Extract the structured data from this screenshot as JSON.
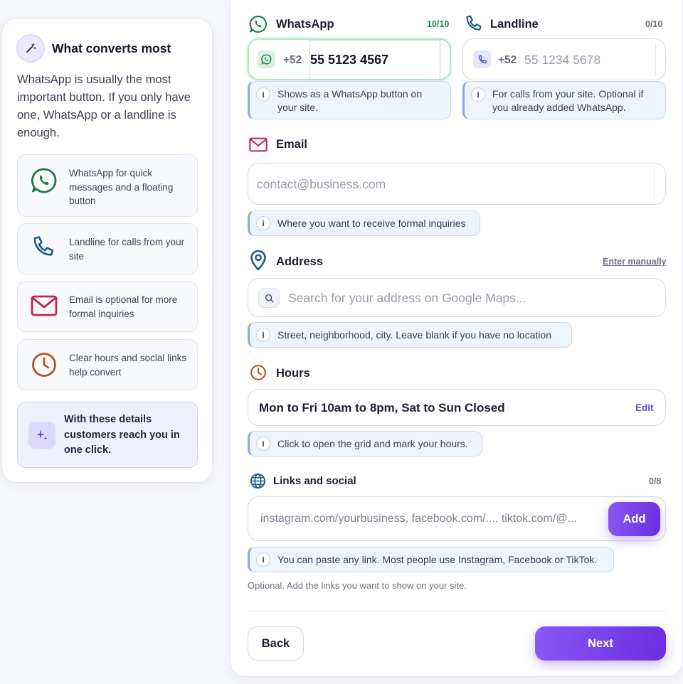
{
  "sidebar": {
    "title": "What converts most",
    "description": "WhatsApp is usually the most important button. If you only have one, WhatsApp or a landline is enough.",
    "tips": [
      {
        "icon": "whatsapp-icon",
        "text": "WhatsApp for quick messages and a floating button"
      },
      {
        "icon": "phone-icon",
        "text": "Landline for calls from your site"
      },
      {
        "icon": "mail-icon",
        "text": "Email is optional for more formal inquiries"
      },
      {
        "icon": "clock-icon",
        "text": "Clear hours and social links help convert"
      }
    ],
    "final_tip": "With these details customers reach you in one click.",
    "colors": {
      "whatsapp": "#1a7a4a",
      "phone": "#1b5e8c",
      "mail": "#c0264e",
      "clock": "#b4541d",
      "accent": "#6a2fe0"
    }
  },
  "whatsapp": {
    "label": "WhatsApp",
    "counter": "10/10",
    "prefix": "+52",
    "value": "55 5123 4567",
    "hint": "Shows as a WhatsApp button on your site."
  },
  "landline": {
    "label": "Landline",
    "counter": "0/10",
    "prefix": "+52",
    "placeholder": "55 1234 5678",
    "hint": "For calls from your site. Optional if you already added WhatsApp."
  },
  "email": {
    "label": "Email",
    "placeholder": "contact@business.com",
    "hint": "Where you want to receive formal inquiries"
  },
  "address": {
    "label": "Address",
    "manual_link": "Enter manually",
    "placeholder": "Search for your address on Google Maps...",
    "hint": "Street, neighborhood, city. Leave blank if you have no location"
  },
  "hours": {
    "label": "Hours",
    "value": "Mon to Fri 10am to 8pm, Sat to Sun Closed",
    "edit_label": "Edit",
    "hint": "Click to open the grid and mark your hours."
  },
  "links": {
    "label": "Links and social",
    "counter": "0/8",
    "placeholder": "instagram.com/yourbusiness, facebook.com/..., tiktok.com/@...",
    "add_label": "Add",
    "hint": "You can paste any link. Most people use Instagram, Facebook or TikTok.",
    "note": "Optional. Add the links you want to show on your site."
  },
  "footer": {
    "back_label": "Back",
    "next_label": "Next"
  }
}
